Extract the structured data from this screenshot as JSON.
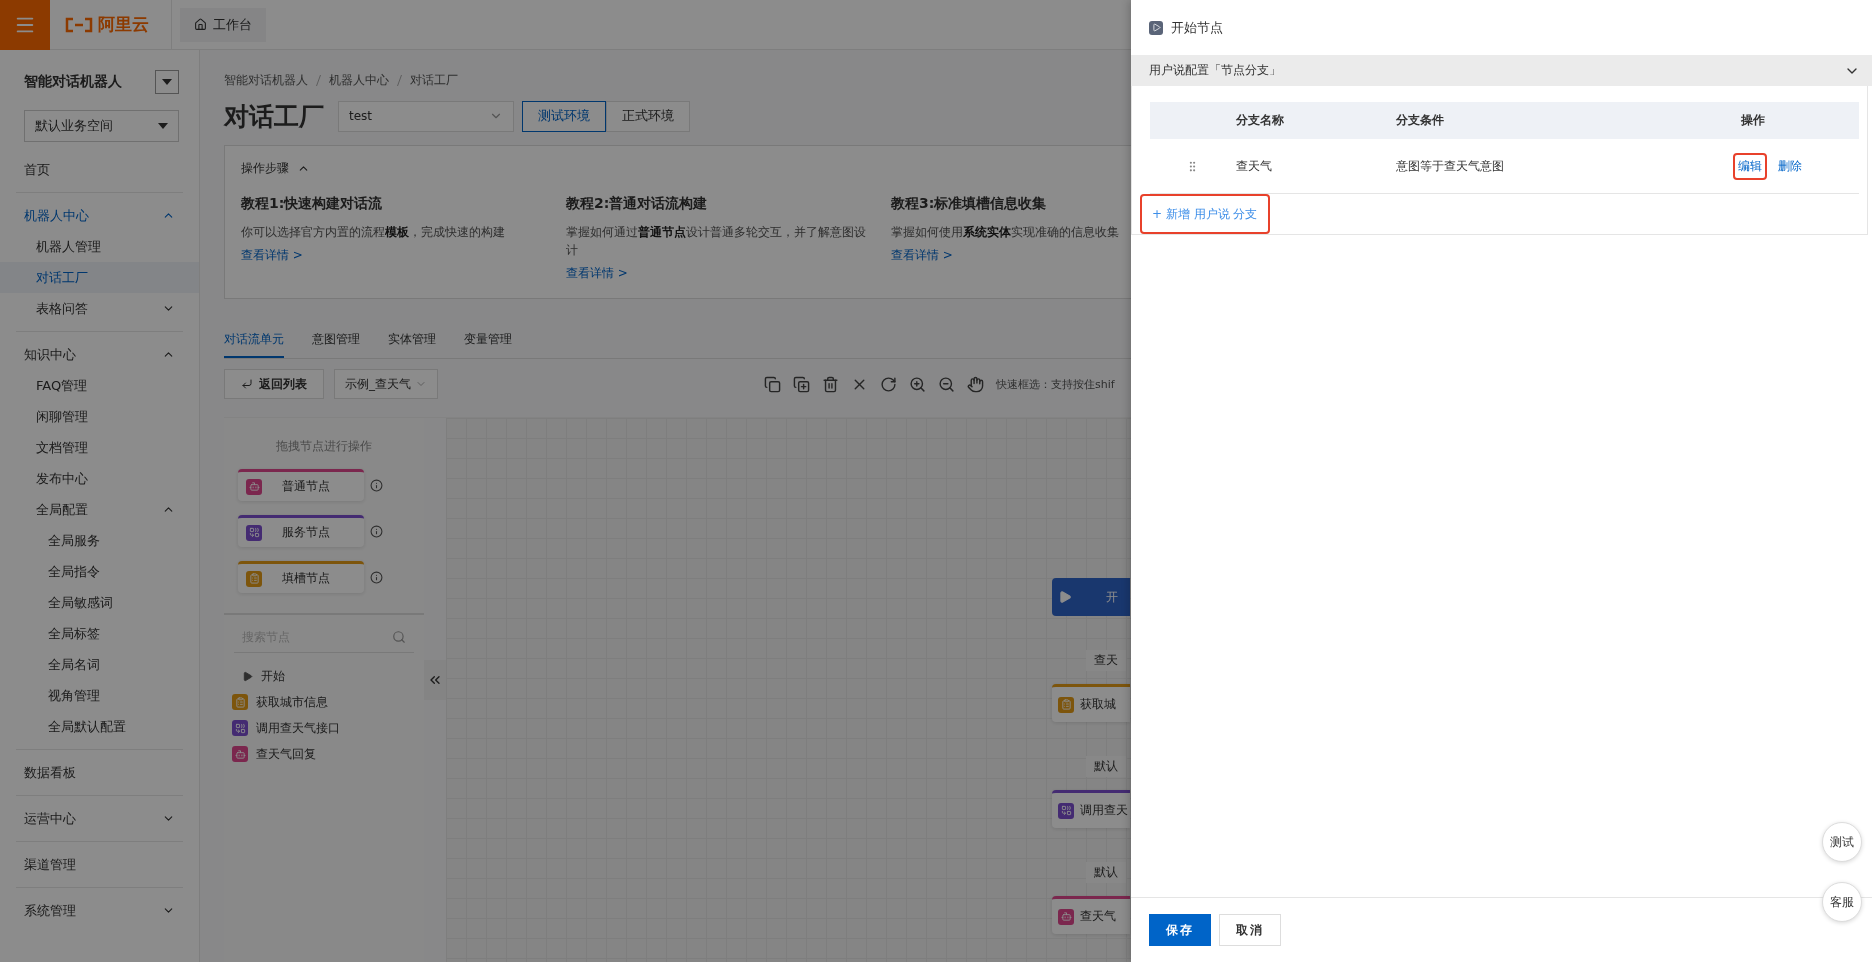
{
  "header": {
    "logo_text": "阿里云",
    "workbench_tab": "工作台"
  },
  "sidebar": {
    "title": "智能对话机器人",
    "workspace_select": "默认业务空间",
    "items": [
      {
        "label": "首页",
        "selected": false
      },
      {
        "label": "机器人中心",
        "selected": true,
        "expanded": true,
        "children": [
          {
            "label": "机器人管理",
            "selected": false
          },
          {
            "label": "对话工厂",
            "selected": true
          },
          {
            "label": "表格问答",
            "selected": false,
            "expanded": false
          }
        ]
      },
      {
        "label": "知识中心",
        "selected": false,
        "expanded": true,
        "children": [
          {
            "label": "FAQ管理",
            "selected": false
          },
          {
            "label": "闲聊管理",
            "selected": false
          },
          {
            "label": "文档管理",
            "selected": false
          },
          {
            "label": "发布中心",
            "selected": false
          },
          {
            "label": "全局配置",
            "selected": false,
            "expanded": true,
            "children": [
              {
                "label": "全局服务",
                "selected": false
              },
              {
                "label": "全局指令",
                "selected": false
              },
              {
                "label": "全局敏感词",
                "selected": false
              },
              {
                "label": "全局标签",
                "selected": false
              },
              {
                "label": "全局名词",
                "selected": false
              },
              {
                "label": "视角管理",
                "selected": false
              },
              {
                "label": "全局默认配置",
                "selected": false
              }
            ]
          }
        ]
      },
      {
        "label": "数据看板",
        "selected": false
      },
      {
        "label": "运营中心",
        "selected": false,
        "expanded": false
      },
      {
        "label": "渠道管理",
        "selected": false
      },
      {
        "label": "系统管理",
        "selected": false,
        "expanded": false
      }
    ]
  },
  "breadcrumb": [
    "智能对话机器人",
    "机器人中心",
    "对话工厂"
  ],
  "page_title": "对话工厂",
  "bot_select": {
    "value": "test"
  },
  "environments": [
    {
      "label": "测试环境",
      "selected": true
    },
    {
      "label": "正式环境",
      "selected": false
    }
  ],
  "steps": {
    "title": "操作步骤",
    "expanded": true,
    "tutorials": [
      {
        "title": "教程1:快速构建对话流",
        "description": "你可以选择官方内置的流程**模板**，完成快速的构建",
        "link": "查看详情 >"
      },
      {
        "title": "教程2:普通对话流构建",
        "description": "掌握如何通过**普通节点**设计普通多轮交互，并了解意图设计",
        "link": "查看详情 >"
      },
      {
        "title": "教程3:标准填槽信息收集",
        "description": "掌握如何使用**系统实体**实现准确的信息收集",
        "link": "查看详情 >"
      }
    ]
  },
  "tabs": [
    {
      "label": "对话流单元",
      "selected": true
    },
    {
      "label": "意图管理",
      "selected": false
    },
    {
      "label": "实体管理",
      "selected": false
    },
    {
      "label": "变量管理",
      "selected": false
    }
  ],
  "toolbar": {
    "back_button": "返回列表",
    "flow_select": "示例_查天气",
    "hint": "快速框选：支持按住shif"
  },
  "palette": {
    "title": "拖拽节点进行操作",
    "nodes": [
      {
        "label": "普通节点",
        "kind": "dialog"
      },
      {
        "label": "服务节点",
        "kind": "service"
      },
      {
        "label": "填槽节点",
        "kind": "slot"
      }
    ],
    "search": {
      "placeholder": "搜索节点"
    },
    "tree": [
      {
        "label": "开始",
        "kind": "start"
      },
      {
        "label": "获取城市信息",
        "kind": "slot"
      },
      {
        "label": "调用查天气接口",
        "kind": "service"
      },
      {
        "label": "查天气回复",
        "kind": "dialog"
      }
    ]
  },
  "canvas": {
    "flow": [
      {
        "kind": "start",
        "label": "开"
      },
      {
        "kind": "edge",
        "label": "查天"
      },
      {
        "kind": "slot",
        "label": "获取城"
      },
      {
        "kind": "edge",
        "label": "默认"
      },
      {
        "kind": "service",
        "label": "调用查天"
      },
      {
        "kind": "edge",
        "label": "默认"
      },
      {
        "kind": "dialog",
        "label": "查天气"
      }
    ]
  },
  "drawer": {
    "title": "开始节点",
    "section": {
      "title": "用户说配置「节点分支」",
      "expanded": true,
      "columns": [
        "分支名称",
        "分支条件",
        "操作"
      ],
      "rows": [
        {
          "name": "查天气",
          "condition": "意图等于查天气意图",
          "actions": [
            {
              "label": "编辑",
              "highlighted": true
            },
            {
              "label": "删除",
              "highlighted": false
            }
          ]
        }
      ],
      "add_button": {
        "label": "+ 新增 用户说 分支",
        "highlighted": true
      }
    },
    "buttons": [
      {
        "label": "保存",
        "kind": "primary"
      },
      {
        "label": "取消",
        "kind": "default"
      }
    ]
  },
  "float_buttons": [
    "测试",
    "客服"
  ]
}
